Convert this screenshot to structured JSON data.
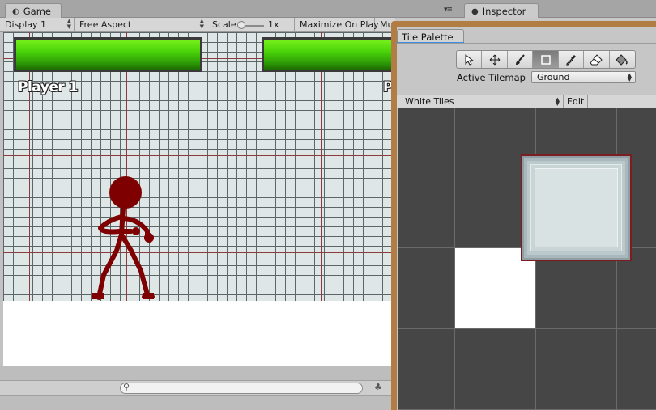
{
  "tabs": {
    "game_label": "Game",
    "inspector_label": "Inspector",
    "panel_menu": "▾≡"
  },
  "game_toolbar": {
    "display": "Display 1",
    "aspect": "Free Aspect",
    "scale_label": "Scale",
    "scale_value": "1x",
    "maximize": "Maximize On Play",
    "mute_partial": "Mu"
  },
  "game_view": {
    "player1_label": "Player 1",
    "player2_label": "P",
    "health_bar_color": "#4ad40a",
    "grid_major_color": "#8a3b3f",
    "stickman_color": "#7e0000"
  },
  "tile_palette": {
    "tab_label": "Tile Palette",
    "tools": [
      {
        "name": "select-tool",
        "glyph": "↖"
      },
      {
        "name": "move-tool",
        "glyph": "✥"
      },
      {
        "name": "paint-brush-tool",
        "glyph": "🖌"
      },
      {
        "name": "box-fill-tool",
        "glyph": "▢"
      },
      {
        "name": "picker-tool",
        "glyph": "✎"
      },
      {
        "name": "eraser-tool",
        "glyph": "⌫"
      },
      {
        "name": "fill-tool",
        "glyph": "◈"
      }
    ],
    "active_tilemap_label": "Active Tilemap",
    "active_tilemap_value": "Ground",
    "palette_value": "White Tiles",
    "edit_label": "Edit"
  }
}
